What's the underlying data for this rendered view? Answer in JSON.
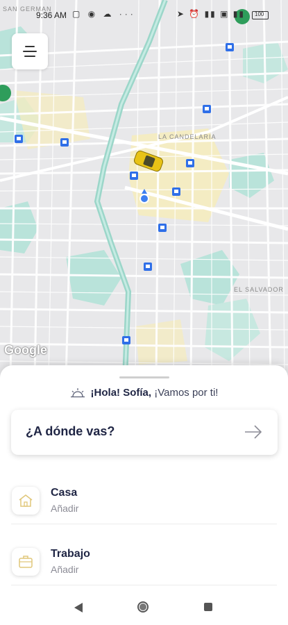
{
  "status_bar": {
    "time": "9:36 AM",
    "left_icons": "▢ ◉ ☁ ···",
    "right_icons": "➤ ⏰ ▮▮ ▣ ▮▮",
    "battery": "100"
  },
  "map": {
    "labels": [
      "SAN GERMAN",
      "LA CANDELARIA",
      "EL SALVADOR"
    ],
    "attribution": "Google",
    "colors": {
      "water": "#b9e3da",
      "highway": "#a7ddd1",
      "zone": "#f6ecbc",
      "station": "#2f6fe8",
      "location": "#3d7ff0",
      "taxi": "#e8c316"
    }
  },
  "greeting": {
    "prefix": "¡Hola! Sofía,",
    "suffix": " ¡Vamos por ti!"
  },
  "destination": {
    "label": "¿A dónde vas?"
  },
  "places": [
    {
      "title": "Casa",
      "subtitle": "Añadir",
      "icon": "home-icon"
    },
    {
      "title": "Trabajo",
      "subtitle": "Añadir",
      "icon": "briefcase-icon"
    }
  ],
  "navigation": {
    "back": "back-icon",
    "home": "home-nav-icon",
    "recents": "recents-icon"
  }
}
